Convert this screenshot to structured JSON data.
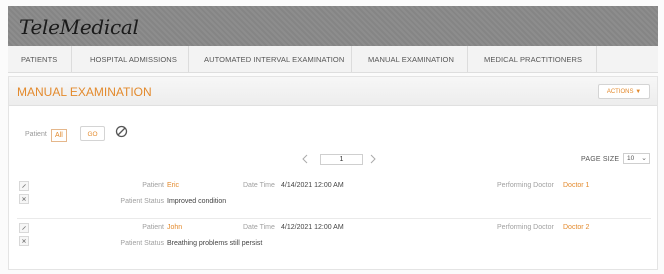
{
  "app": {
    "logo": "TeleMedical"
  },
  "nav": {
    "items": [
      {
        "label": "PATIENTS"
      },
      {
        "label": "HOSPITAL ADMISSIONS"
      },
      {
        "label": "AUTOMATED INTERVAL EXAMINATION"
      },
      {
        "label": "MANUAL EXAMINATION"
      },
      {
        "label": "MEDICAL PRACTITIONERS"
      }
    ]
  },
  "panel": {
    "title": "MANUAL EXAMINATION",
    "actions_label": "ACTIONS",
    "filter": {
      "label": "Patient",
      "tag": "All",
      "go_label": "GO"
    },
    "pager": {
      "page": "1",
      "page_size_label": "PAGE SIZE",
      "page_size": "10"
    },
    "rows": [
      {
        "patient_label": "Patient",
        "patient": "Eric",
        "datetime_label": "Date Time",
        "datetime": "4/14/2021 12:00 AM",
        "doctor_label": "Performing Doctor",
        "doctor": "Doctor 1",
        "status_label": "Patient Status",
        "status": "Improved condition"
      },
      {
        "patient_label": "Patient",
        "patient": "John",
        "datetime_label": "Date Time",
        "datetime": "4/12/2021 12:00 AM",
        "doctor_label": "Performing Doctor",
        "doctor": "Doctor 2",
        "status_label": "Patient Status",
        "status": "Breathing problems still persist"
      }
    ]
  }
}
